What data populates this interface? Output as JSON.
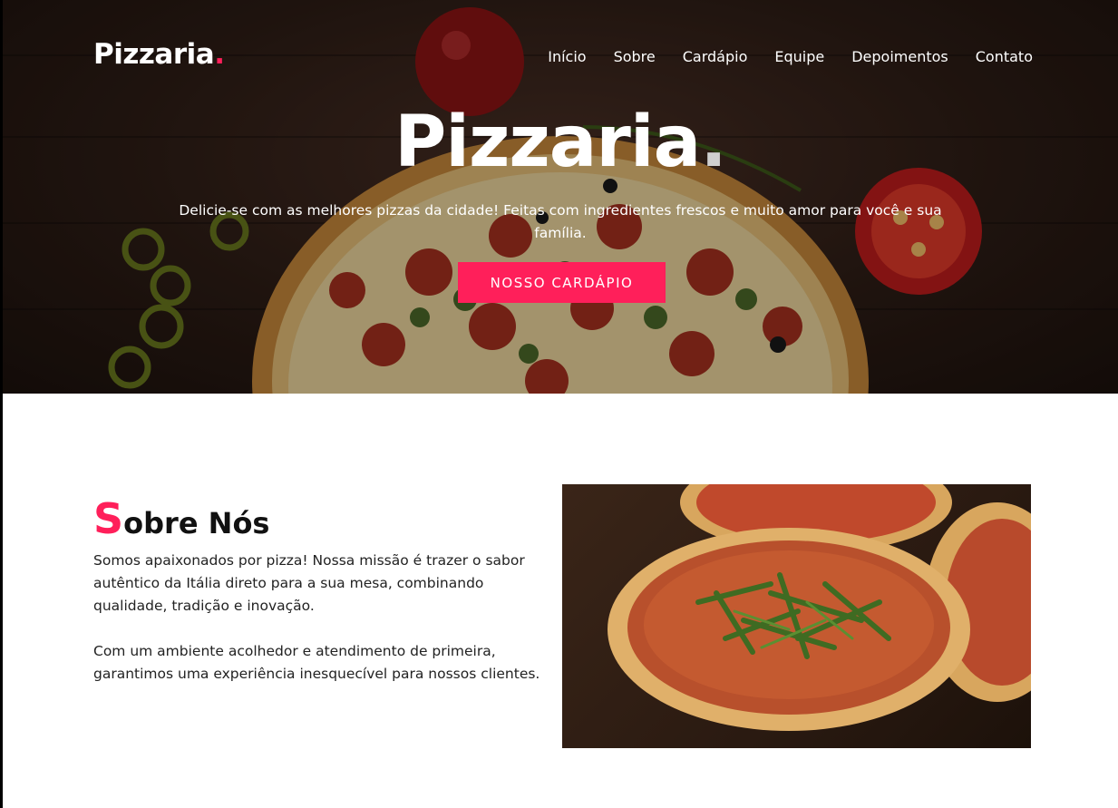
{
  "brand": {
    "name": "Pizzaria",
    "dot": "."
  },
  "nav": {
    "items": [
      "Início",
      "Sobre",
      "Cardápio",
      "Equipe",
      "Depoimentos",
      "Contato"
    ]
  },
  "hero": {
    "title": "Pizzaria",
    "title_dot": ".",
    "subtitle": "Delicie-se com as melhores pizzas da cidade! Feitas com ingredientes frescos e muito amor para você e sua família.",
    "button_label": "NOSSO CARDÁPIO"
  },
  "about": {
    "title_cap": "S",
    "title_rest": "obre Nós",
    "paragraph1": "Somos apaixonados por pizza! Nossa missão é trazer o sabor autêntico da Itália direto para a sua mesa, combinando qualidade, tradição e inovação.",
    "paragraph2": "Com um ambiente acolhedor e atendimento de primeira, garantimos uma experiência inesquecível para nossos clientes."
  },
  "colors": {
    "accent": "#ff1f5a",
    "text": "#111111",
    "hero_bg": "#2e1d16"
  }
}
